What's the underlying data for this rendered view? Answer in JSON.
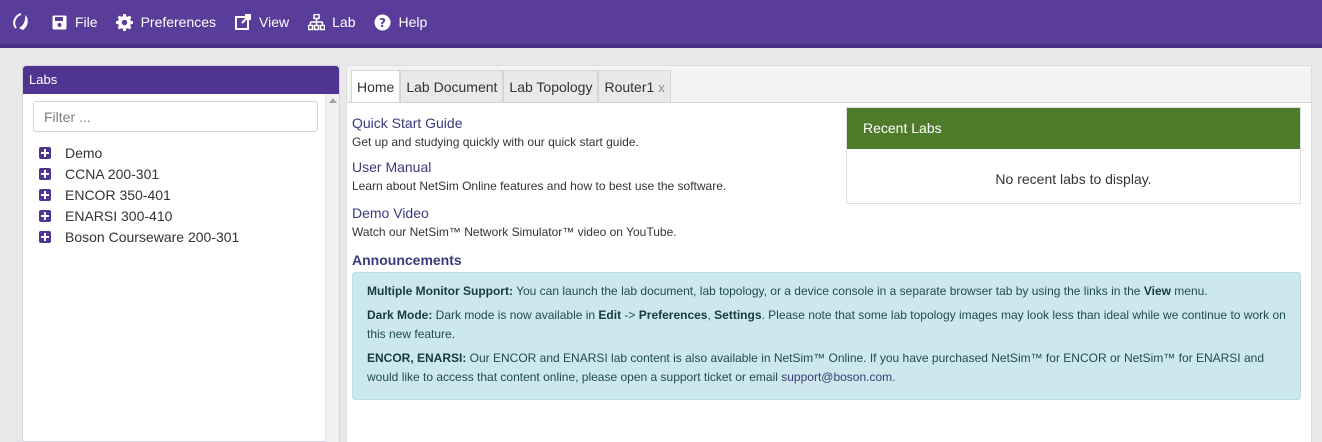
{
  "topbar": {
    "items": [
      {
        "label": "File",
        "icon": "save-icon"
      },
      {
        "label": "Preferences",
        "icon": "gear-icon"
      },
      {
        "label": "View",
        "icon": "external-link-icon"
      },
      {
        "label": "Lab",
        "icon": "network-icon"
      },
      {
        "label": "Help",
        "icon": "question-circle-icon"
      }
    ],
    "bg_color": "#5a3d9a"
  },
  "labs": {
    "title": "Labs",
    "filter_placeholder": "Filter ...",
    "items": [
      "Demo",
      "CCNA 200-301",
      "ENCOR 350-401",
      "ENARSI 300-410",
      "Boson Courseware 200-301"
    ]
  },
  "tabs": [
    {
      "label": "Home"
    },
    {
      "label": "Lab Document"
    },
    {
      "label": "Lab Topology"
    },
    {
      "label": "Router1",
      "close": "x"
    }
  ],
  "home": {
    "quick_start": {
      "title": "Quick Start Guide",
      "desc": "Get up and studying quickly with our quick start guide."
    },
    "user_manual": {
      "title": "User Manual",
      "desc": "Learn about NetSim Online features and how to best use the software."
    },
    "demo_video": {
      "title": "Demo Video",
      "desc": "Watch our NetSim™ Network Simulator™ video on YouTube."
    },
    "announcements_title": "Announcements",
    "announcements": {
      "a1_bold": "Multiple Monitor Support:",
      "a1_text": " You can launch the lab document, lab topology, or a device console in a separate browser tab by using the links in the ",
      "a1_bold2": "View",
      "a1_end": " menu.",
      "a2_bold": "Dark Mode:",
      "a2_text": " Dark mode is now available in ",
      "a2_edit": "Edit",
      "a2_arrow": " -> ",
      "a2_pref": "Preferences",
      "a2_comma": ", ",
      "a2_settings": "Settings",
      "a2_end": ". Please note that some lab topology images may look less than ideal while we continue to work on this new feature.",
      "a3_bold": "ENCOR, ENARSI:",
      "a3_text": " Our ENCOR and ENARSI lab content is also available in NetSim™ Online. If you have purchased NetSim™ for ENCOR or NetSim™ for ENARSI and would like to access that content online, please open a support ticket or email ",
      "a3_link": "support@boson.com",
      "a3_end": "."
    }
  },
  "recent_labs": {
    "title": "Recent Labs",
    "empty": "No recent labs to display.",
    "header_color": "#4f7c2b"
  }
}
